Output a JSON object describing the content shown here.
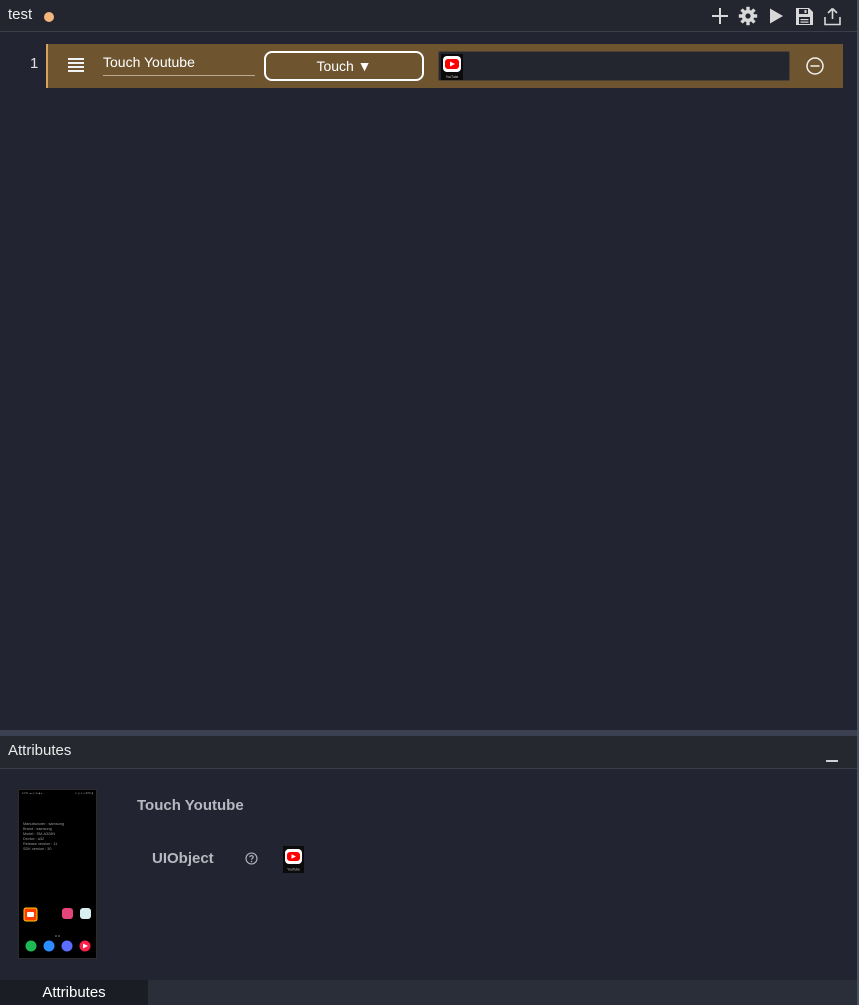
{
  "tab": {
    "title": "test",
    "unsaved_indicator_color": "#f3b77d"
  },
  "toolbar": {
    "icons": [
      "plus-icon",
      "gear-icon",
      "play-icon",
      "save-icon",
      "export-icon"
    ]
  },
  "steps": [
    {
      "number": "1",
      "name": "Touch Youtube",
      "action": "Touch ▼",
      "target_icon": "youtube-app-icon",
      "target_icon_caption": "YouTube",
      "row_color": "#6e5530"
    }
  ],
  "attributes_panel": {
    "title": "Attributes",
    "step_name": "Touch Youtube",
    "attribute_label": "UIObject",
    "attribute_value_icon": "youtube-app-icon",
    "attribute_value_caption": "YouTube",
    "device_screenshot": {
      "status_bar": "12:01 ☁ ◎ ⊕ ◆ ▴",
      "status_bar_right": "✦ ◎ ▾ ⊿ 83% ▮",
      "info_lines": [
        "Manufacturer : samsung",
        "Brand : samsung",
        "Model : SM-A326N",
        "Device : a32",
        "Release version : 11",
        "SDK version : 30"
      ]
    }
  },
  "bottom_tabs": [
    {
      "label": "Attributes"
    }
  ],
  "colors": {
    "background": "#222531",
    "accent": "#d6a25d",
    "youtube_red": "#ff0000"
  }
}
